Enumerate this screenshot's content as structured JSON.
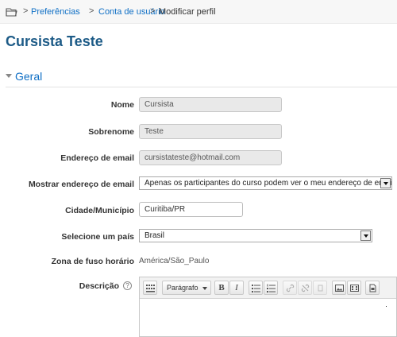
{
  "breadcrumb": {
    "home_icon": "home-folder-icon",
    "items": [
      "Preferências",
      "Conta de usuário",
      "Modificar perfil"
    ],
    "separator": ">"
  },
  "page": {
    "title": "Cursista Teste"
  },
  "section": {
    "title": "Geral",
    "state": "expanded"
  },
  "form": {
    "nome": {
      "label": "Nome",
      "value": "Cursista"
    },
    "sobrenome": {
      "label": "Sobrenome",
      "value": "Teste"
    },
    "email": {
      "label": "Endereço de email",
      "value": "cursistateste@hotmail.com"
    },
    "email_display": {
      "label": "Mostrar endereço de email",
      "value": "Apenas os participantes do curso podem ver o meu endereço de email"
    },
    "cidade": {
      "label": "Cidade/Município",
      "value": "Curitiba/PR"
    },
    "pais": {
      "label": "Selecione um país",
      "value": "Brasil"
    },
    "fuso": {
      "label": "Zona de fuso horário",
      "value": "América/São_Paulo"
    },
    "descricao": {
      "label": "Descrição",
      "help_icon": "help-icon"
    }
  },
  "editor": {
    "paragraph_label": "Parágrafo",
    "bold_label": "B",
    "italic_label": "I",
    "icons": [
      "toolbar-toggle-icon",
      "unordered-list-icon",
      "ordered-list-icon",
      "link-icon",
      "unlink-icon",
      "emoticon-icon",
      "image-icon",
      "media-icon",
      "file-manager-icon"
    ]
  }
}
